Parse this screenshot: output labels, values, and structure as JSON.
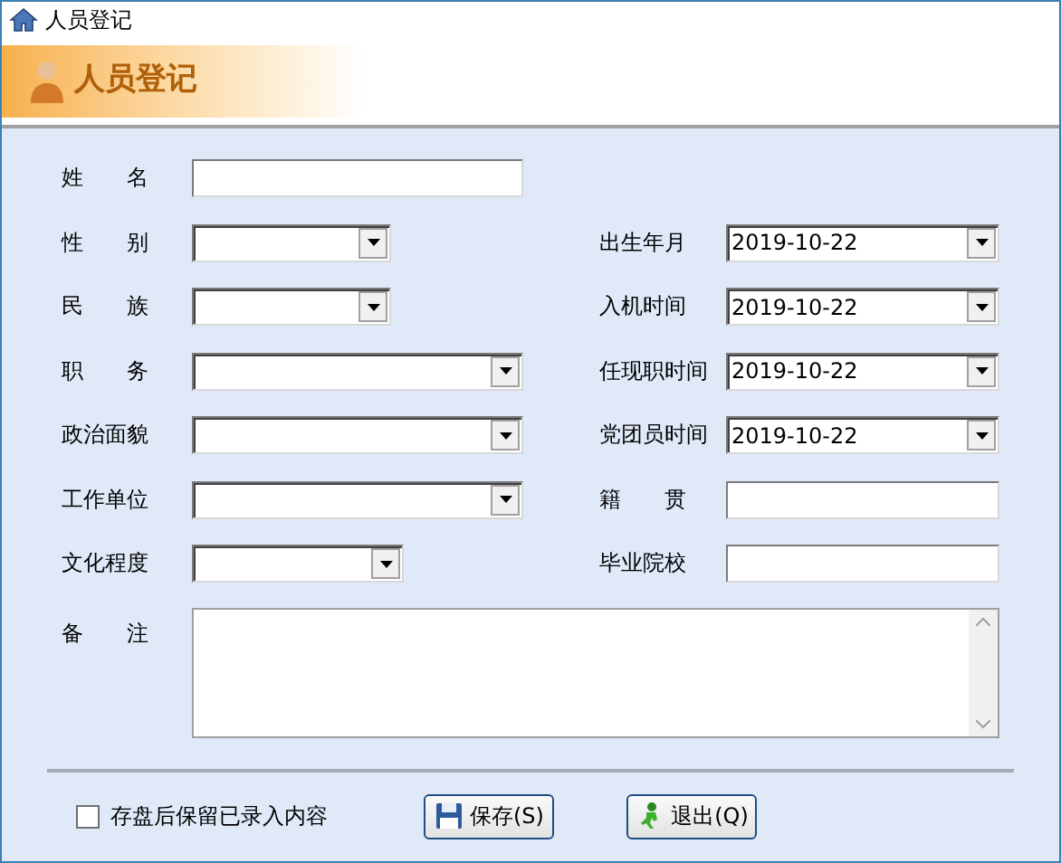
{
  "window": {
    "title": "人员登记"
  },
  "header": {
    "title": "人员登记"
  },
  "left_fields": [
    {
      "label": "姓　　名",
      "kind": "text"
    },
    {
      "label": "性　　别",
      "kind": "combo"
    },
    {
      "label": "民　　族",
      "kind": "combo"
    },
    {
      "label": "职　　务",
      "kind": "combo"
    },
    {
      "label": "政治面貌",
      "kind": "combo"
    },
    {
      "label": "工作单位",
      "kind": "combo"
    },
    {
      "label": "文化程度",
      "kind": "combo"
    }
  ],
  "right_fields": [
    {
      "label": "出生年月",
      "kind": "combo",
      "value": "2019-10-22"
    },
    {
      "label": "入机时间",
      "kind": "combo",
      "value": "2019-10-22"
    },
    {
      "label": "任现职时间",
      "kind": "combo",
      "value": "2019-10-22"
    },
    {
      "label": "党团员时间",
      "kind": "combo",
      "value": "2019-10-22"
    },
    {
      "label": "籍　　贯",
      "kind": "text"
    },
    {
      "label": "毕业院校",
      "kind": "text"
    }
  ],
  "notes": {
    "label": "备　　注"
  },
  "keep_checkbox": {
    "label": "存盘后保留已录入内容",
    "checked": false
  },
  "buttons": [
    {
      "label": "保存(S)",
      "kind": "save"
    },
    {
      "label": "退出(Q)",
      "kind": "exit"
    }
  ]
}
